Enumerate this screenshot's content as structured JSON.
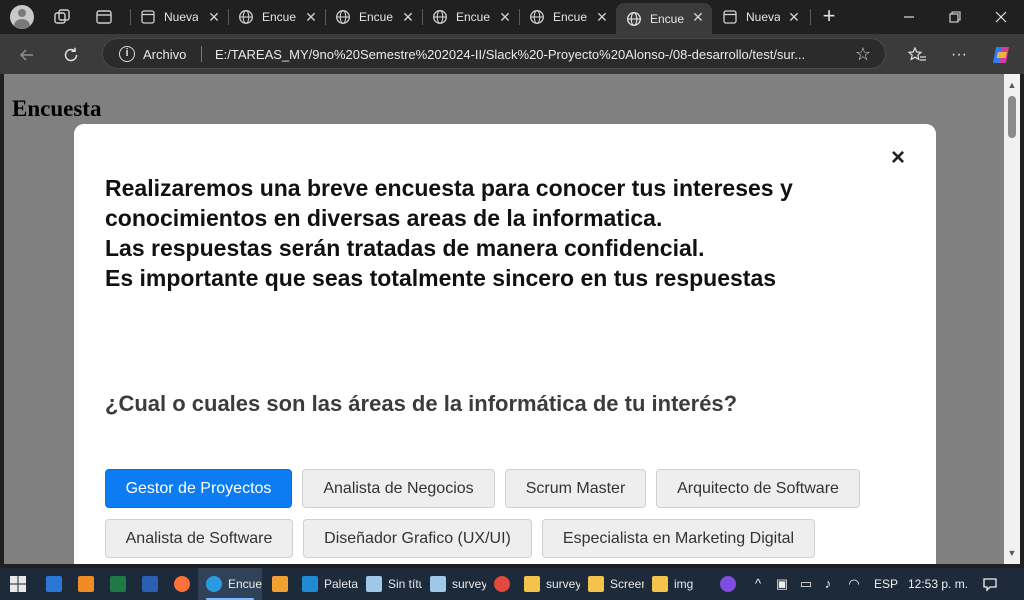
{
  "tabs": [
    {
      "title": "Nueva pestaña",
      "icon": "page-icon"
    },
    {
      "title": "Encuesta",
      "icon": "globe-icon"
    },
    {
      "title": "Encuesta",
      "icon": "globe-icon"
    },
    {
      "title": "Encuesta",
      "icon": "globe-icon"
    },
    {
      "title": "Encuesta",
      "icon": "globe-icon"
    },
    {
      "title": "Encuesta",
      "icon": "globe-icon",
      "active": true
    },
    {
      "title": "Nueva pestaña",
      "icon": "page-icon"
    }
  ],
  "address": {
    "scheme_label": "Archivo",
    "url": "E:/TAREAS_MY/9no%20Semestre%202024-II/Slack%20-Proyecto%20Alonso-/08-desarrollo/test/sur..."
  },
  "page": {
    "heading": "Encuesta",
    "modal": {
      "close_symbol": "×",
      "intro_lines": [
        "Realizaremos una breve encuesta para conocer tus intereses y",
        "conocimientos en diversas areas de la informatica.",
        "Las respuestas serán tratadas de manera confidencial.",
        "Es importante que seas totalmente sincero en tus respuestas"
      ],
      "question": "¿Cual o cuales son las áreas de la informática de tu interés?",
      "options": [
        {
          "label": "Gestor de Proyectos",
          "selected": true
        },
        {
          "label": "Analista de Negocios",
          "selected": false
        },
        {
          "label": "Scrum Master",
          "selected": false
        },
        {
          "label": "Arquitecto de Software",
          "selected": false
        },
        {
          "label": "Analista de Software",
          "selected": false
        },
        {
          "label": "Diseñador Grafico (UX/UI)",
          "selected": false
        },
        {
          "label": "Especialista en Marketing Digital",
          "selected": false
        }
      ]
    }
  },
  "taskbar": {
    "apps": [
      {
        "label": "Encuesta",
        "icon": "edge-icon",
        "active": true
      },
      {
        "label": "Paleta",
        "icon": "vscode-icon"
      },
      {
        "label": "Sin título",
        "icon": "notepad-icon"
      },
      {
        "label": "survey",
        "icon": "notepad-icon"
      },
      {
        "label": "survey",
        "icon": "folder-icon"
      },
      {
        "label": "Screenshots",
        "icon": "folder-icon"
      },
      {
        "label": "img",
        "icon": "folder-icon"
      }
    ],
    "language": "ESP",
    "clock": "12:53 p. m."
  },
  "colors": {
    "accent": "#0d7cf2",
    "backdrop": "#808080",
    "titlebar": "#202020",
    "taskbar": "#1c2a3a"
  }
}
